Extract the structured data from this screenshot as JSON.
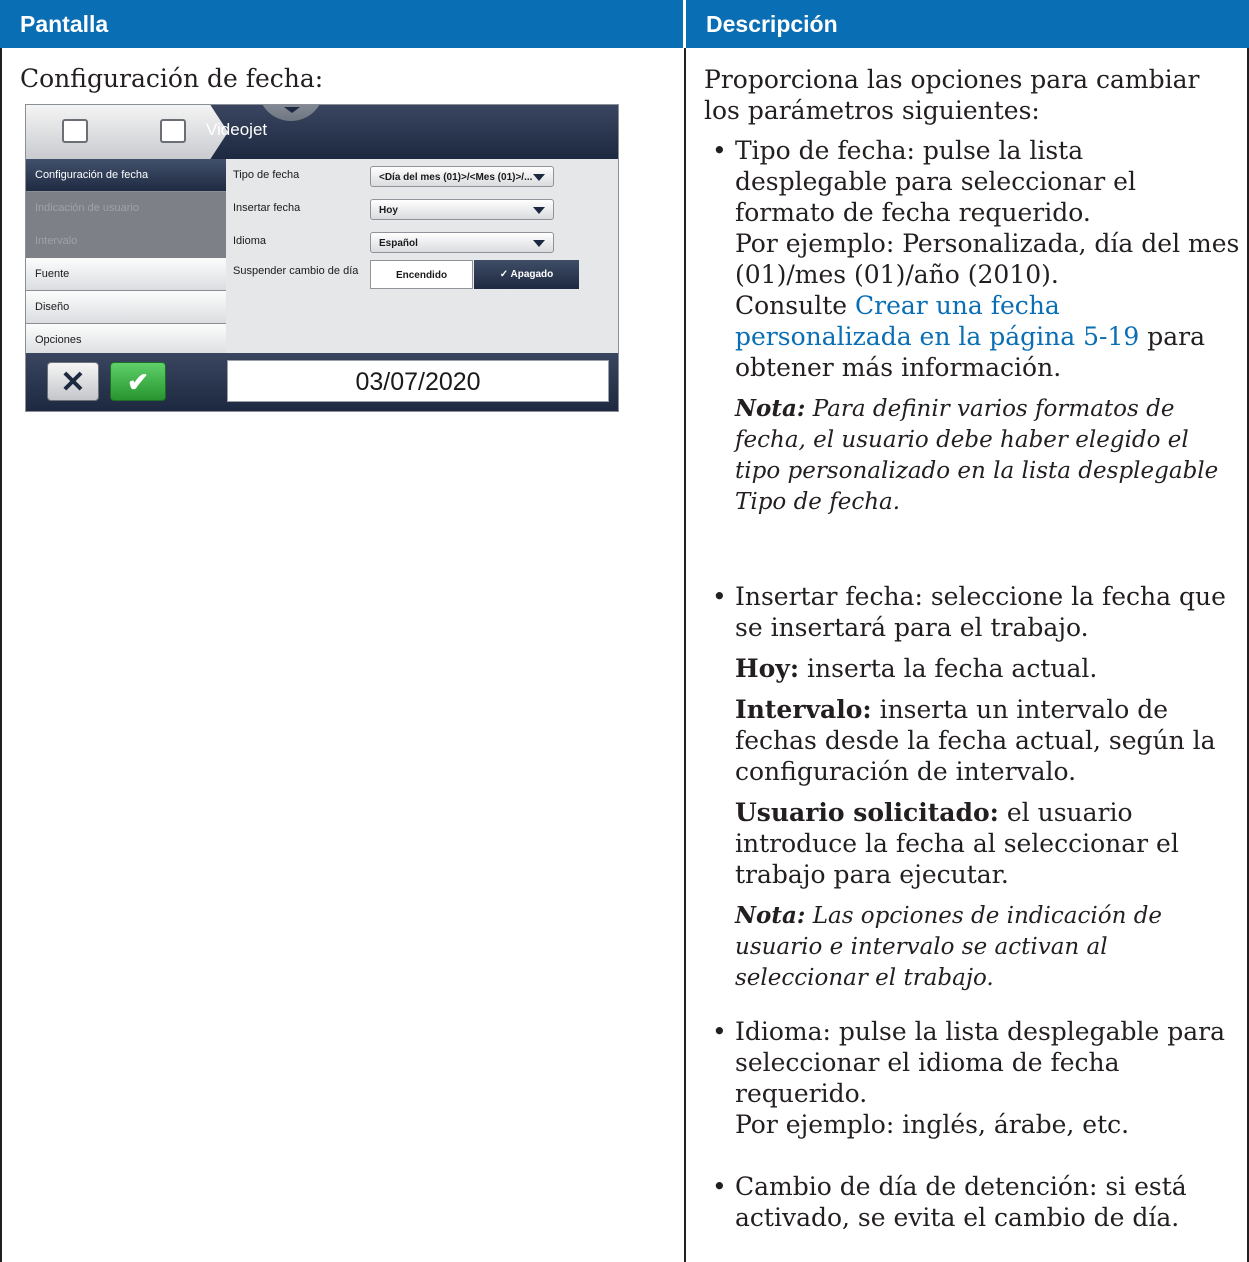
{
  "table": {
    "col_screen": "Pantalla",
    "col_description": "Descripción"
  },
  "left": {
    "heading": "Configuración de fecha:"
  },
  "ui": {
    "title": "Videojet",
    "sidebar": [
      {
        "label": "Configuración de fecha",
        "state": "active"
      },
      {
        "label": "Indicación de usuario",
        "state": "disabled"
      },
      {
        "label": "Intervalo",
        "state": "disabled"
      },
      {
        "label": "Fuente",
        "state": "normal"
      },
      {
        "label": "Diseño",
        "state": "normal"
      },
      {
        "label": "Opciones",
        "state": "normal"
      }
    ],
    "fields": {
      "date_type_label": "Tipo de fecha",
      "date_type_value": "<Día del mes (01)>/<Mes (01)>/...",
      "insert_date_label": "Insertar fecha",
      "insert_date_value": "Hoy",
      "language_label": "Idioma",
      "language_value": "Español",
      "suspend_label": "Suspender cambio de día",
      "toggle_on": "Encendido",
      "toggle_off": "✓ Apagado"
    },
    "cancel_glyph": "✕",
    "ok_glyph": "✔",
    "date_display": "03/07/2020"
  },
  "right": {
    "intro": "Proporciona las opciones para cambiar los parámetros siguientes:",
    "bullet1": {
      "line1": "Tipo de fecha: pulse la lista desplegable para seleccionar el formato de fecha requerido.",
      "line2": "Por ejemplo: Personalizada, día del mes (01)/mes (01)/año (2010).",
      "see": "Consulte",
      "link": "Crear una fecha personalizada en la página 5-19",
      "after_link": "para obtener más información.",
      "note_label": "Nota:",
      "note_text": "Para definir varios formatos de fecha, el usuario debe haber elegido el tipo personalizado en la lista desplegable Tipo de fecha."
    },
    "bullet2": {
      "line1": "Insertar fecha: seleccione la fecha que se insertará para el trabajo.",
      "today_label": "Hoy:",
      "today_text": "inserta la fecha actual.",
      "interval_label": "Intervalo:",
      "interval_text": "inserta un intervalo de fechas desde la fecha actual, según la configuración de intervalo.",
      "user_label": "Usuario solicitado:",
      "user_text": "el usuario introduce la fecha al seleccionar el trabajo para ejecutar.",
      "note_label": "Nota:",
      "note_text": "Las opciones de indicación de usuario e intervalo se activan al seleccionar el trabajo."
    },
    "bullet3": {
      "line1": "Idioma: pulse la lista desplegable para seleccionar el idioma de fecha requerido.",
      "line2": "Por ejemplo: inglés, árabe, etc."
    },
    "bullet4": {
      "line1": "Cambio de día de detención: si está activado, se evita el cambio de día."
    },
    "bullet_glyph": "•"
  }
}
